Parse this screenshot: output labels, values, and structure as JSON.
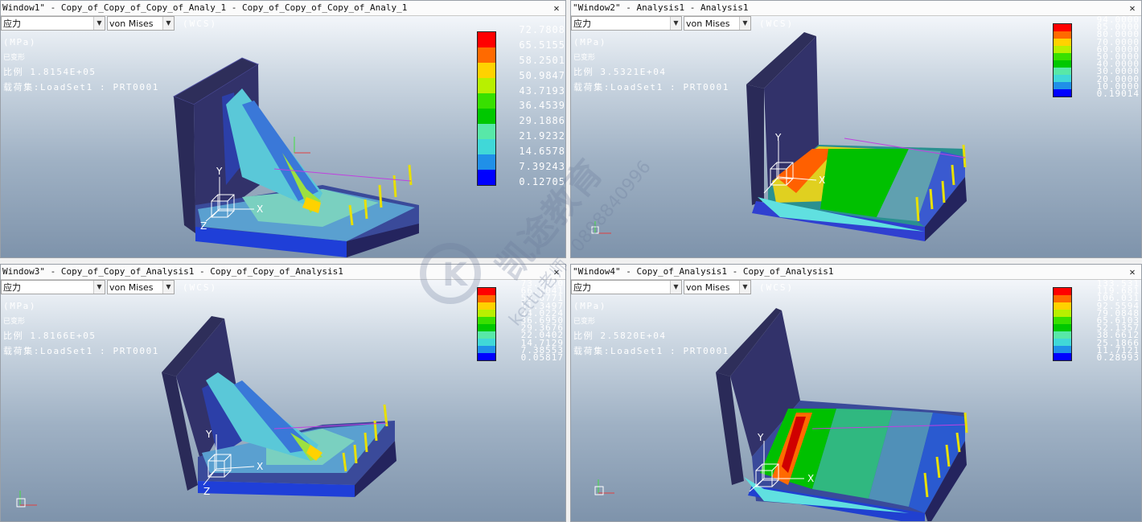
{
  "windows": [
    {
      "title": "Window1\" - Copy_of_Copy_of_Copy_of_Analy_1 - Copy_of_Copy_of_Copy_of_Analy_1",
      "quantity": "应力",
      "measure": "von Mises",
      "wcs": "(WCS)",
      "units": "(MPa)",
      "deformed": "已变形",
      "scale": "比例  1.8154E+05",
      "loadset": "载荷集:LoadSet1 :  PRT0001",
      "legend": [
        "72.7808",
        "65.5155",
        "58.2501",
        "50.9847",
        "43.7193",
        "36.4539",
        "29.1886",
        "21.9232",
        "14.6578",
        "7.39243",
        "0.12705"
      ]
    },
    {
      "title": "\"Window2\" - Analysis1 - Analysis1",
      "quantity": "应力",
      "measure": "von Mises",
      "wcs": "(WCS)",
      "units": "(MPa)",
      "deformed": "已变形",
      "scale": "比例  3.5321E+04",
      "loadset": "载荷集:LoadSet1 :  PRT0001",
      "legend": [
        "94.0000",
        "85.0000",
        "80.0000",
        "70.0000",
        "60.0000",
        "50.0000",
        "40.0000",
        "30.0000",
        "20.0000",
        "10.0000",
        "0.19014"
      ]
    },
    {
      "title": "Window3\" - Copy_of_Copy_of_Analysis1 - Copy_of_Copy_of_Analysis1",
      "quantity": "应力",
      "measure": "von Mises",
      "wcs": "(WCS)",
      "units": "(MPa)",
      "deformed": "已变形",
      "scale": "比例  1.8166E+05",
      "loadset": "载荷集:LoadSet1 :  PRT0001",
      "legend": [
        "73.3310",
        "66.0041",
        "58.6771",
        "51.3497",
        "44.0224",
        "36.6950",
        "29.3676",
        "22.0402",
        "14.7129",
        "7.38553",
        "0.05817"
      ]
    },
    {
      "title": "\"Window4\" - Copy_of_Analysis1 - Copy_of_Analysis1",
      "quantity": "应力",
      "measure": "von Mises",
      "wcs": "(WCS)",
      "units": "(MPa)",
      "deformed": "已变形",
      "scale": "比例  2.5820E+04",
      "loadset": "载荷集:LoadSet1 :  PRT0001",
      "legend": [
        "133.531",
        "119.681",
        "106.031",
        "92.5594",
        "79.0848",
        "65.6103",
        "52.1357",
        "38.6612",
        "25.1866",
        "11.7121",
        "0.28993"
      ]
    }
  ],
  "legend_colors": [
    "#ff0000",
    "#ff6a00",
    "#ffd200",
    "#b8f000",
    "#38e000",
    "#00c800",
    "#58e8a8",
    "#40d8d8",
    "#2090e8",
    "#0000ff",
    "#24245e"
  ],
  "watermark": {
    "brand": "凯途教育",
    "teacher": "kettu老师",
    "phone": "0898840996"
  }
}
